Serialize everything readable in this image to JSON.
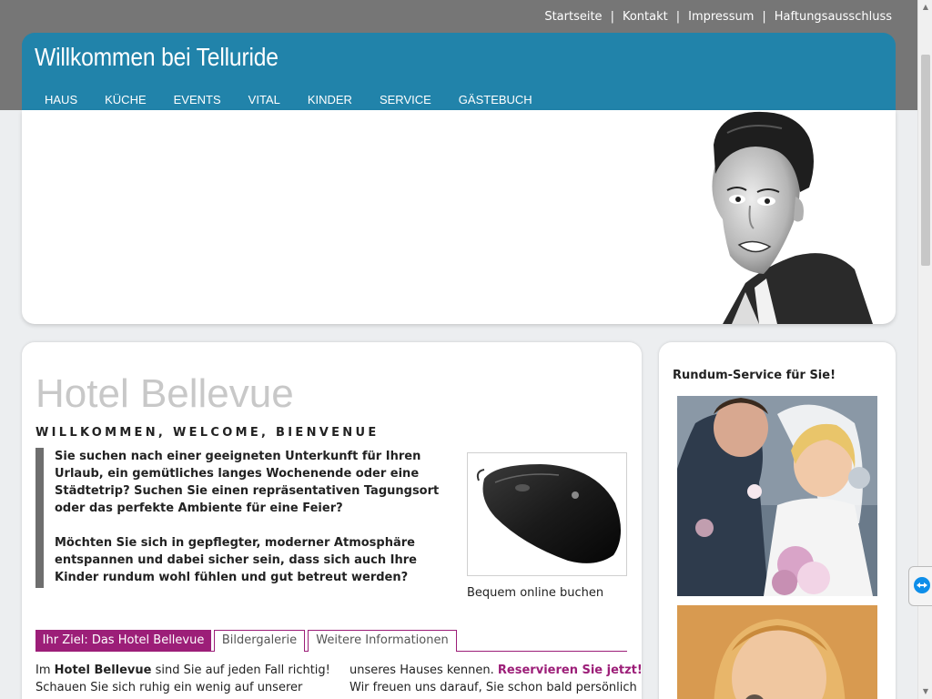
{
  "top_links": [
    "Startseite",
    "Kontakt",
    "Impressum",
    "Haftungsausschluss"
  ],
  "site_title": "Willkommen bei Telluride",
  "nav": [
    "HAUS",
    "KÜCHE",
    "EVENTS",
    "VITAL",
    "KINDER",
    "SERVICE",
    "GÄSTEBUCH"
  ],
  "main": {
    "title": "Hotel Bellevue",
    "subtitle": "WILLKOMMEN, WELCOME, BIENVENUE",
    "intro_p1": "Sie suchen nach einer geeigneten Unterkunft für Ihren Urlaub, ein gemütliches langes Wochenende oder eine Städtetrip? Suchen Sie einen repräsentativen Tagungsort oder das perfekte Ambiente für eine Feier?",
    "intro_p2": "Möchten Sie sich in gepflegter, moderner Atmosphäre entspannen und dabei sicher sein, dass sich auch Ihre Kinder rundum wohl fühlen und gut betreut werden?",
    "image_caption": "Bequem online buchen",
    "tabs": [
      "Ihr Ziel: Das Hotel Bellevue",
      "Bildergalerie",
      "Weitere Informationen"
    ],
    "col_left": {
      "prefix": "Im ",
      "bold": "Hotel Bellevue",
      "rest": " sind Sie auf jeden Fall richtig! Schauen Sie sich ruhig ein wenig auf unserer"
    },
    "col_right": {
      "prefix": "unseres Hauses kennen. ",
      "link": "Reservieren Sie jetzt!",
      "rest": " Wir freuen uns darauf, Sie schon bald persönlich"
    }
  },
  "sidebar": {
    "title": "Rundum-Service für Sie!"
  },
  "colors": {
    "header_blue": "#2183aa",
    "accent_purple": "#9c1e78",
    "top_band": "#767676"
  }
}
